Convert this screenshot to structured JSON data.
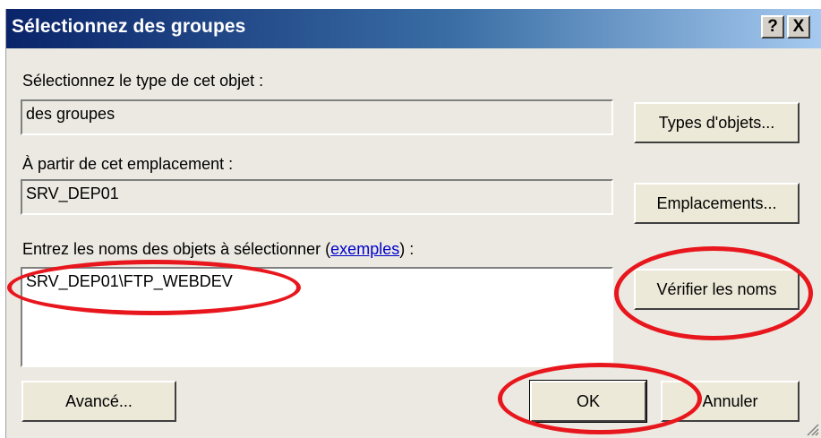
{
  "window": {
    "title": "Sélectionnez des groupes",
    "help_label": "?",
    "close_label": "X"
  },
  "object_type": {
    "label": "Sélectionnez le type de cet objet :",
    "value": "des groupes",
    "button": "Types d'objets..."
  },
  "location": {
    "label": "À partir de cet emplacement :",
    "value": "SRV_DEP01",
    "button": "Emplacements..."
  },
  "names": {
    "label_prefix": "Entrez les noms des objets à sélectionner (",
    "label_link": "exemples",
    "label_suffix": ") :",
    "value": "SRV_DEP01\\FTP_WEBDEV",
    "check_button": "Vérifier les noms"
  },
  "footer": {
    "advanced_button": "Avancé...",
    "ok_button": "OK",
    "cancel_button": "Annuler"
  },
  "colors": {
    "annotation": "#e8161d",
    "title_gradient_start": "#0a246a",
    "title_gradient_end": "#a6caf0",
    "dialog_bg": "#ebe9e1"
  }
}
